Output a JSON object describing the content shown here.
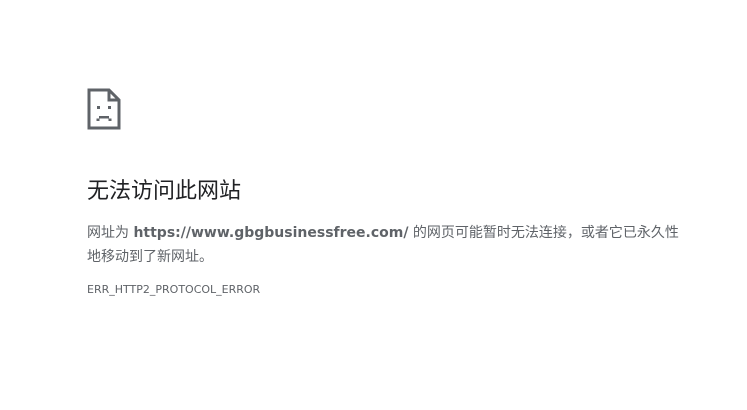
{
  "error_page": {
    "icon": "sad-page-icon",
    "heading": "无法访问此网站",
    "message_prefix": "网址为 ",
    "host": "https://www.gbgbusinessfree.com/",
    "message_suffix": " 的网页可能暂时无法连接，或者它已永久性地移动到了新网址。",
    "error_code": "ERR_HTTP2_PROTOCOL_ERROR"
  },
  "colors": {
    "heading": "#202124",
    "body_text": "#5f6368",
    "icon": "#5f6368",
    "background": "#ffffff"
  }
}
